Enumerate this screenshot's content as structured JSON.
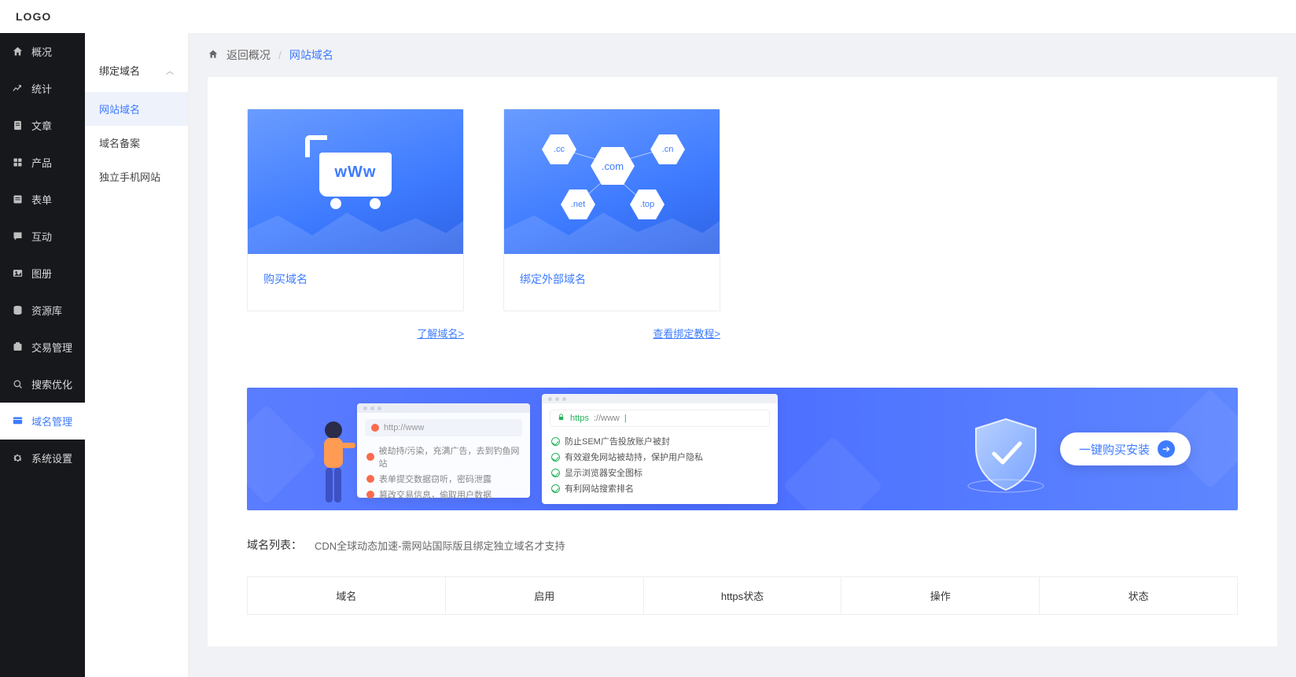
{
  "logo": "LOGO",
  "sidebar": [
    {
      "icon": "home",
      "label": "概况"
    },
    {
      "icon": "chart",
      "label": "统计"
    },
    {
      "icon": "doc",
      "label": "文章"
    },
    {
      "icon": "grid",
      "label": "产品"
    },
    {
      "icon": "form",
      "label": "表单"
    },
    {
      "icon": "chat",
      "label": "互动"
    },
    {
      "icon": "album",
      "label": "图册"
    },
    {
      "icon": "db",
      "label": "资源库"
    },
    {
      "icon": "trade",
      "label": "交易管理"
    },
    {
      "icon": "seo",
      "label": "搜索优化"
    },
    {
      "icon": "domain",
      "label": "域名管理",
      "active": true
    },
    {
      "icon": "gear",
      "label": "系统设置"
    }
  ],
  "subbar": {
    "group": "绑定域名",
    "items": [
      {
        "label": "网站域名",
        "active": true
      },
      {
        "label": "域名备案"
      },
      {
        "label": "独立手机网站"
      }
    ]
  },
  "breadcrumb": {
    "back": "返回概况",
    "current": "网站域名"
  },
  "cards": {
    "buy": {
      "title": "购买域名",
      "link": "了解域名>",
      "cart_text": "wWw"
    },
    "bind": {
      "title": "绑定外部域名",
      "link": "查看绑定教程>",
      "tlds": {
        "cc": ".cc",
        "com": ".com",
        "cn": ".cn",
        "net": ".net",
        "top": ".top"
      }
    }
  },
  "banner": {
    "http_url": "http://www",
    "https_prefix": "https",
    "https_rest": "://www",
    "left_list": [
      "被劫持/污染，充满广告，去到钓鱼网站",
      "表单提交数据窃听，密码泄露",
      "篡改交易信息，偷取用户数据"
    ],
    "right_list": [
      "防止SEM广告投放账户被封",
      "有效避免网站被劫持，保护用户隐私",
      "显示浏览器安全图标",
      "有利网站搜索排名"
    ],
    "cta": "一键购买安装"
  },
  "domain_list": {
    "title": "域名列表：",
    "note": "CDN全球动态加速-需网站国际版且绑定独立域名才支持",
    "cols": [
      "域名",
      "启用",
      "https状态",
      "操作",
      "状态"
    ]
  }
}
